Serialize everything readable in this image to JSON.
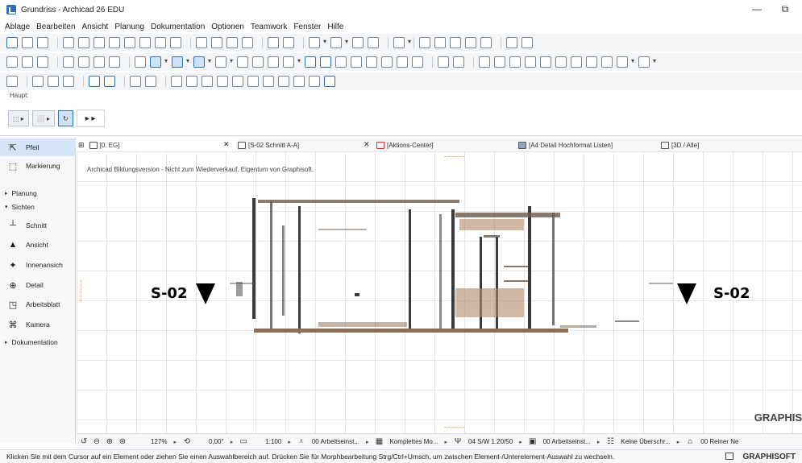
{
  "window": {
    "title": "Grundriss - Archicad 26 EDU",
    "minimize_glyph": "—",
    "restore_glyph": "⧉"
  },
  "menubar": {
    "items": [
      "Ablage",
      "Bearbeiten",
      "Ansicht",
      "Planung",
      "Dokumentation",
      "Optionen",
      "Teamwork",
      "Fenster",
      "Hilfe"
    ]
  },
  "toolbox": {
    "header": "Haupt:",
    "tools": [
      {
        "name": "pointer-tool",
        "label": "Pfeil",
        "icon": "pointer-icon",
        "glyph": "⇱"
      },
      {
        "name": "marquee-tool",
        "label": "Markierung",
        "icon": "marquee-icon",
        "glyph": "⬚"
      }
    ],
    "group_planung": "Planung",
    "group_sichten": "Sichten",
    "sichten": [
      {
        "name": "schnitt",
        "label": "Schnitt",
        "icon": "section-icon",
        "glyph": "┴"
      },
      {
        "name": "ansicht",
        "label": "Ansicht",
        "icon": "elevation-icon",
        "glyph": "▲"
      },
      {
        "name": "innenansicht",
        "label": "Innenansich",
        "icon": "interior-elevation-icon",
        "glyph": "✦"
      },
      {
        "name": "detail",
        "label": "Detail",
        "icon": "detail-icon",
        "glyph": "⊕"
      },
      {
        "name": "arbeitsblatt",
        "label": "Arbeitsblatt",
        "icon": "worksheet-icon",
        "glyph": "◳"
      },
      {
        "name": "kamera",
        "label": "Kamera",
        "icon": "camera-icon",
        "glyph": "⌘"
      }
    ],
    "group_dokumentation": "Dokumentation"
  },
  "tabs": [
    {
      "label": "[0. EG]",
      "icon": "floor-plan-icon",
      "active": true
    },
    {
      "label": "[S-02 Schnitt A-A]",
      "icon": "section-tab-icon",
      "active": false
    },
    {
      "label": "[Aktions-Center]",
      "icon": "action-center-icon",
      "active": false
    },
    {
      "label": "[A4 Detail Hochformat Listen]",
      "icon": "layout-icon",
      "active": false
    },
    {
      "label": "[3D / Alle]",
      "icon": "3d-icon",
      "active": false
    }
  ],
  "canvas": {
    "edu_note": "Archicad Bildungsversion - Nicht zum Wiederverkauf. Eigentum von Graphisoft.",
    "section_marker_left": "S-02",
    "section_marker_right": "S-02",
    "brand": "GRAPHIS"
  },
  "statusbar": {
    "zoom": "127%",
    "angle": "0,00°",
    "scale": "1:100",
    "layer_combo": "00 Arbeitseinst...",
    "model_view": "Komplettes Mo...",
    "pen_set": "04 S/W 1:20/50",
    "graphic_override": "00 Arbeitseinst...",
    "renovation": "Keine Überschr...",
    "structure": "00 Reiner Ne"
  },
  "hintbar": {
    "text": "Klicken Sie mit dem Cursor auf ein Element oder ziehen Sie einen Auswahlbereich auf. Drücken Sie für Morphbearbeitung Strg/Ctrl+Umsch, um zwischen Element-/Unterelement-Auswahl zu wechseln.",
    "brand": "GRAPHISOFT"
  },
  "colors": {
    "accent": "#2f6db5",
    "selection": "#d3e4f6",
    "grid": "#e3e6ea"
  }
}
